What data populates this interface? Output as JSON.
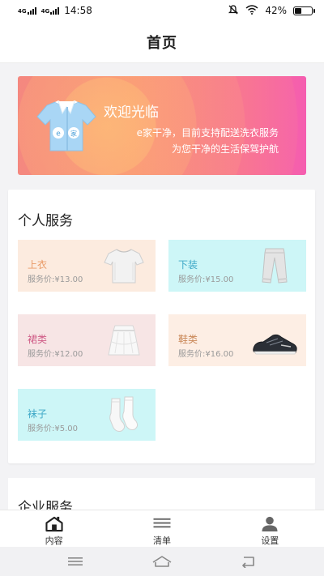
{
  "status_bar": {
    "network_1": "4G",
    "network_2": "4G",
    "time": "14:58",
    "battery_percent": "42%",
    "battery_level": 0.42
  },
  "header": {
    "title": "首页"
  },
  "banner": {
    "title": "欢迎光临",
    "line1": "e家干净，目前支持配送洗衣服务",
    "line2": "为您干净的生活保驾护航",
    "shirt_letters": [
      "e",
      "家"
    ]
  },
  "personal_services": {
    "title": "个人服务",
    "items": [
      {
        "name": "上衣",
        "price": "服务价:¥13.00",
        "icon": "tshirt-icon"
      },
      {
        "name": "下装",
        "price": "服务价:¥15.00",
        "icon": "pants-icon"
      },
      {
        "name": "裙类",
        "price": "服务价:¥12.00",
        "icon": "skirt-icon"
      },
      {
        "name": "鞋类",
        "price": "服务价:¥16.00",
        "icon": "shoe-icon"
      },
      {
        "name": "袜子",
        "price": "服务价:¥5.00",
        "icon": "socks-icon"
      }
    ]
  },
  "enterprise_services": {
    "title": "企业服务"
  },
  "bottom_nav": {
    "items": [
      {
        "label": "内容",
        "icon": "home-icon",
        "active": true
      },
      {
        "label": "清单",
        "icon": "list-icon",
        "active": false
      },
      {
        "label": "设置",
        "icon": "user-icon",
        "active": false
      }
    ]
  },
  "system_nav": {
    "icons": [
      "menu-icon",
      "home-outline-icon",
      "back-icon"
    ]
  },
  "colors": {
    "banner_start": "#f07a7c",
    "banner_end": "#f55db0",
    "tile_peach": "#fcebdf",
    "tile_cyan": "#cdf6f7",
    "tile_pink": "#f7e5e5"
  }
}
